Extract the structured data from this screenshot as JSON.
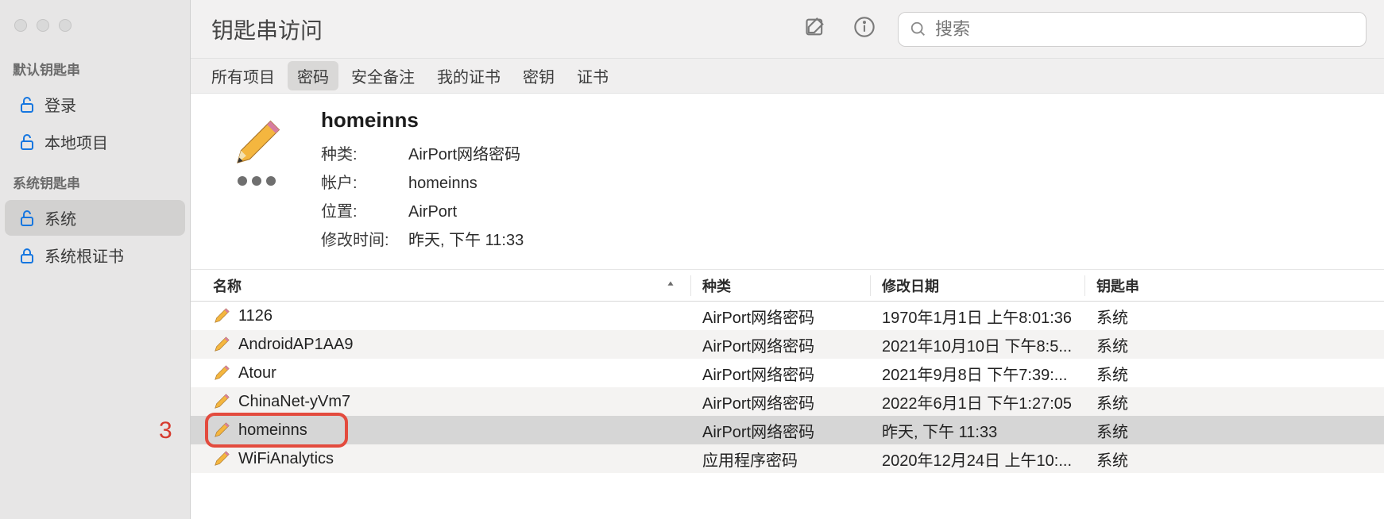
{
  "window": {
    "title": "钥匙串访问"
  },
  "search": {
    "placeholder": "搜索"
  },
  "sidebar": {
    "sections": [
      {
        "title": "默认钥匙串",
        "items": [
          {
            "label": "登录",
            "icon": "unlock",
            "selected": false
          },
          {
            "label": "本地项目",
            "icon": "unlock",
            "selected": false
          }
        ]
      },
      {
        "title": "系统钥匙串",
        "items": [
          {
            "label": "系统",
            "icon": "unlock",
            "selected": true
          },
          {
            "label": "系统根证书",
            "icon": "lock",
            "selected": false
          }
        ]
      }
    ]
  },
  "scope": {
    "items": [
      {
        "label": "所有项目",
        "selected": false
      },
      {
        "label": "密码",
        "selected": true
      },
      {
        "label": "安全备注",
        "selected": false
      },
      {
        "label": "我的证书",
        "selected": false
      },
      {
        "label": "密钥",
        "selected": false
      },
      {
        "label": "证书",
        "selected": false
      }
    ]
  },
  "detail": {
    "name": "homeinns",
    "kind_label": "种类:",
    "kind_value": "AirPort网络密码",
    "account_label": "帐户:",
    "account_value": "homeinns",
    "where_label": "位置:",
    "where_value": "AirPort",
    "modified_label": "修改时间:",
    "modified_value": "昨天, 下午 11:33"
  },
  "table": {
    "columns": {
      "name": "名称",
      "kind": "种类",
      "date": "修改日期",
      "chain": "钥匙串"
    },
    "rows": [
      {
        "name": "1126",
        "kind": "AirPort网络密码",
        "date": "1970年1月1日 上午8:01:36",
        "chain": "系统",
        "selected": false
      },
      {
        "name": "AndroidAP1AA9",
        "kind": "AirPort网络密码",
        "date": "2021年10月10日 下午8:5...",
        "chain": "系统",
        "selected": false
      },
      {
        "name": "Atour",
        "kind": "AirPort网络密码",
        "date": "2021年9月8日 下午7:39:...",
        "chain": "系统",
        "selected": false
      },
      {
        "name": "ChinaNet-yVm7",
        "kind": "AirPort网络密码",
        "date": "2022年6月1日 下午1:27:05",
        "chain": "系统",
        "selected": false
      },
      {
        "name": "homeinns",
        "kind": "AirPort网络密码",
        "date": "昨天, 下午 11:33",
        "chain": "系统",
        "selected": true
      },
      {
        "name": "WiFiAnalytics",
        "kind": "应用程序密码",
        "date": "2020年12月24日 上午10:...",
        "chain": "系统",
        "selected": false
      }
    ]
  },
  "annotation": {
    "label": "3"
  }
}
